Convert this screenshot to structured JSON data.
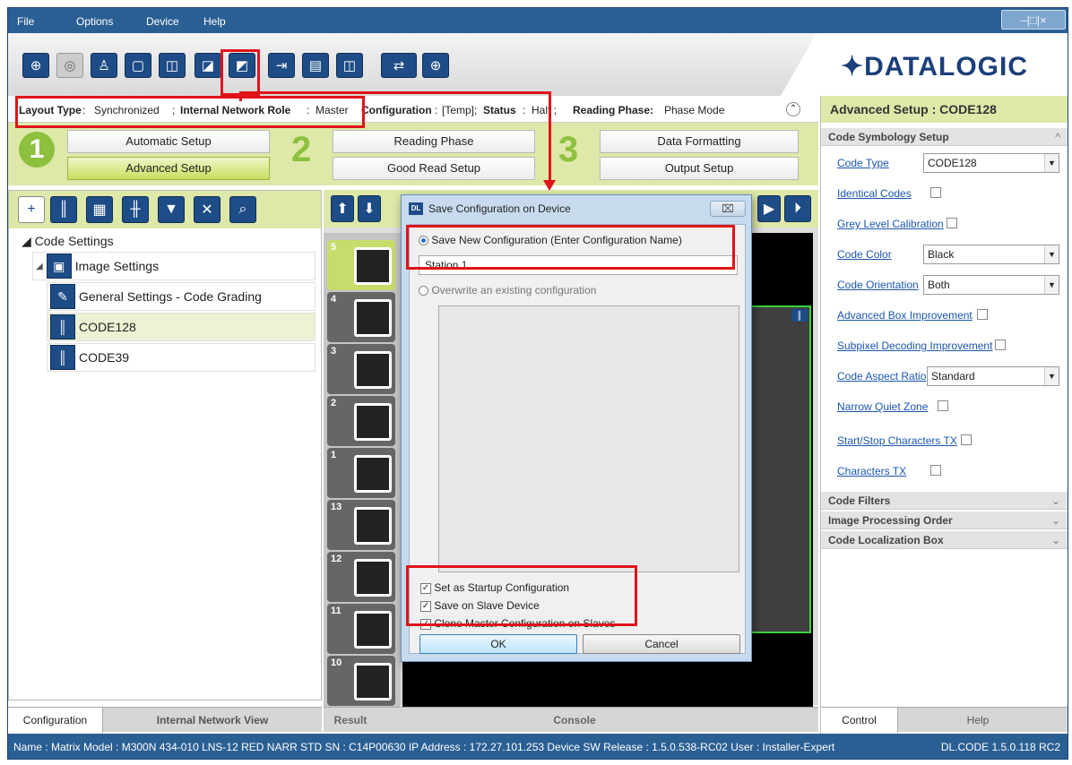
{
  "menu": {
    "file": "File",
    "options": "Options",
    "device": "Device",
    "help": "Help"
  },
  "window_controls": "–|□|×",
  "logo": "✦DATALOGIC",
  "toolbar_icons": [
    "plus-circle",
    "grey-lens",
    "person",
    "window",
    "device-search",
    "device-save",
    "export",
    "save-doc",
    "device-doc",
    "config-transfer",
    "crosshair"
  ],
  "status_line": {
    "layout_type_label": "Layout Type",
    "layout_type_value": "Synchronized",
    "network_role_label": "Internal Network Role",
    "network_role_value": "Master",
    "configuration_label": "Configuration",
    "configuration_value": "[Temp];",
    "status_label": "Status",
    "status_value": "Halt ;",
    "reading_phase_label": "Reading Phase:",
    "reading_phase_value": "Phase Mode"
  },
  "steps": {
    "num1": "1",
    "num2": "2",
    "num3": "3",
    "automatic_setup": "Automatic Setup",
    "advanced_setup": "Advanced Setup",
    "reading_phase": "Reading Phase",
    "good_read_setup": "Good Read Setup",
    "data_formatting": "Data Formatting",
    "output_setup": "Output Setup"
  },
  "tree": {
    "root": "◢ Code Settings",
    "image_settings": "Image Settings",
    "general_settings": "General Settings - Code Grading",
    "code128": "CODE128",
    "code39": "CODE39"
  },
  "left_tabs": {
    "configuration": "Configuration",
    "internal_network_view": "Internal Network View"
  },
  "thumbs": [
    "5",
    "4",
    "3",
    "2",
    "1",
    "13",
    "12",
    "11",
    "10"
  ],
  "result_tabs": {
    "result": "Result",
    "console": "Console"
  },
  "right_panel": {
    "title": "Advanced Setup : CODE128",
    "code_symbology_setup": "Code Symbology Setup",
    "code_type_label": "Code Type",
    "code_type_value": "CODE128",
    "identical_codes": "Identical Codes",
    "grey_level_calibration": "Grey Level Calibration",
    "code_color_label": "Code Color",
    "code_color_value": "Black",
    "code_orientation_label": "Code Orientation",
    "code_orientation_value": "Both",
    "advanced_box_improvement": "Advanced Box Improvement",
    "subpixel_decoding_improvement": "Subpixel Decoding Improvement",
    "code_aspect_ratio_label": "Code Aspect Ratio",
    "code_aspect_ratio_value": "Standard",
    "narrow_quiet_zone": "Narrow Quiet Zone",
    "start_stop_characters_tx": "Start/Stop Characters TX",
    "characters_tx": "Characters TX",
    "code_filters": "Code Filters",
    "image_processing_order": "Image Processing Order",
    "code_localization_box": "Code Localization Box",
    "tab_control": "Control",
    "tab_help": "Help"
  },
  "dialog": {
    "title": "Save Configuration on Device",
    "save_new_label": "Save New Configuration (Enter Configuration Name)",
    "name_value": "Station 1",
    "overwrite_label": "Overwrite an existing configuration",
    "startup_label": "Set as Startup Configuration",
    "save_slave_label": "Save on Slave Device",
    "clone_label": "Clone Master Configuration on Slaves",
    "ok": "OK",
    "cancel": "Cancel",
    "close": "⌧"
  },
  "footer": {
    "info": "Name : Matrix  Model : M300N 434-010 LNS-12 RED NARR STD   SN : C14P00630   IP Address : 172.27.101.253   Device SW Release : 1.5.0.538-RC02   User : Installer-Expert",
    "version": "DL.CODE 1.5.0.118 RC2"
  },
  "colors": {
    "accent_green": "#8cc03e",
    "panel_green": "#dee8a8",
    "brand_blue": "#2a5f94",
    "highlight_red": "#e0131a"
  }
}
